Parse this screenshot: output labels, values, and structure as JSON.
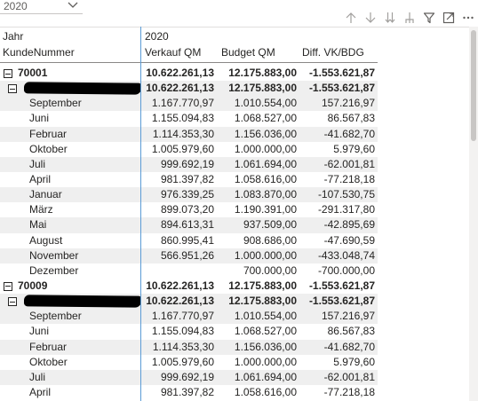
{
  "slicer": {
    "selected": "2020",
    "icon": "chevron-down-icon"
  },
  "toolbar": {
    "icons": [
      "drill-up-icon",
      "drill-down-icon",
      "expand-all-down-icon",
      "expand-hierarchy-icon",
      "filter-icon",
      "focus-mode-icon",
      "more-options-icon"
    ]
  },
  "matrix": {
    "col_header_field": "Jahr",
    "col_header_value": "2020",
    "row_header": "KundeNummer",
    "measures": [
      "Verkauf QM",
      "Budget QM",
      "Diff. VK/BDG"
    ],
    "rows": [
      {
        "level": 0,
        "label": "70001",
        "v1": "10.622.261,13",
        "v2": "12.175.883,00",
        "v3": "-1.553.621,87"
      },
      {
        "level": 1,
        "label": "",
        "redacted": true,
        "v1": "10.622.261,13",
        "v2": "12.175.883,00",
        "v3": "-1.553.621,87"
      },
      {
        "level": 2,
        "label": "September",
        "v1": "1.167.770,97",
        "v2": "1.010.554,00",
        "v3": "157.216,97"
      },
      {
        "level": 2,
        "label": "Juni",
        "v1": "1.155.094,83",
        "v2": "1.068.527,00",
        "v3": "86.567,83"
      },
      {
        "level": 2,
        "label": "Februar",
        "v1": "1.114.353,30",
        "v2": "1.156.036,00",
        "v3": "-41.682,70"
      },
      {
        "level": 2,
        "label": "Oktober",
        "v1": "1.005.979,60",
        "v2": "1.000.000,00",
        "v3": "5.979,60"
      },
      {
        "level": 2,
        "label": "Juli",
        "v1": "999.692,19",
        "v2": "1.061.694,00",
        "v3": "-62.001,81"
      },
      {
        "level": 2,
        "label": "April",
        "v1": "981.397,82",
        "v2": "1.058.616,00",
        "v3": "-77.218,18"
      },
      {
        "level": 2,
        "label": "Januar",
        "v1": "976.339,25",
        "v2": "1.083.870,00",
        "v3": "-107.530,75"
      },
      {
        "level": 2,
        "label": "März",
        "v1": "899.073,20",
        "v2": "1.190.391,00",
        "v3": "-291.317,80"
      },
      {
        "level": 2,
        "label": "Mai",
        "v1": "894.613,31",
        "v2": "937.509,00",
        "v3": "-42.895,69"
      },
      {
        "level": 2,
        "label": "August",
        "v1": "860.995,41",
        "v2": "908.686,00",
        "v3": "-47.690,59"
      },
      {
        "level": 2,
        "label": "November",
        "v1": "566.951,26",
        "v2": "1.000.000,00",
        "v3": "-433.048,74"
      },
      {
        "level": 2,
        "label": "Dezember",
        "v1": "",
        "v2": "700.000,00",
        "v3": "-700.000,00"
      },
      {
        "level": 0,
        "label": "70009",
        "v1": "10.622.261,13",
        "v2": "12.175.883,00",
        "v3": "-1.553.621,87"
      },
      {
        "level": 1,
        "label": "",
        "redacted": true,
        "v1": "10.622.261,13",
        "v2": "12.175.883,00",
        "v3": "-1.553.621,87"
      },
      {
        "level": 2,
        "label": "September",
        "v1": "1.167.770,97",
        "v2": "1.010.554,00",
        "v3": "157.216,97"
      },
      {
        "level": 2,
        "label": "Juni",
        "v1": "1.155.094,83",
        "v2": "1.068.527,00",
        "v3": "86.567,83"
      },
      {
        "level": 2,
        "label": "Februar",
        "v1": "1.114.353,30",
        "v2": "1.156.036,00",
        "v3": "-41.682,70"
      },
      {
        "level": 2,
        "label": "Oktober",
        "v1": "1.005.979,60",
        "v2": "1.000.000,00",
        "v3": "5.979,60"
      },
      {
        "level": 2,
        "label": "Juli",
        "v1": "999.692,19",
        "v2": "1.061.694,00",
        "v3": "-62.001,81"
      },
      {
        "level": 2,
        "label": "April",
        "v1": "981.397,82",
        "v2": "1.058.616,00",
        "v3": "-77.218,18"
      }
    ]
  },
  "colors": {
    "accent_line": "#5b9bd5",
    "row_shade": "#efefef",
    "text": "#252423"
  }
}
